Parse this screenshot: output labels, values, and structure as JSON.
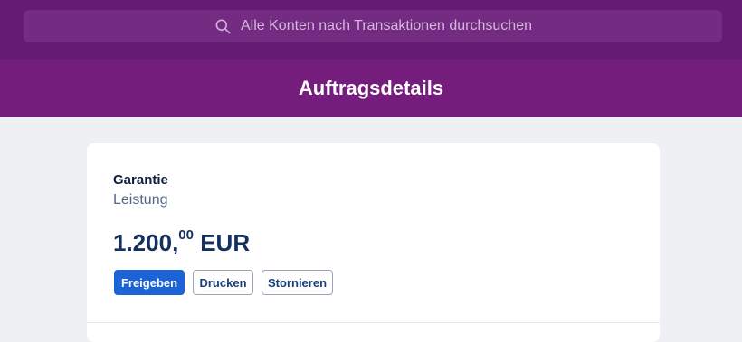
{
  "search": {
    "placeholder": "Alle Konten nach Transaktionen durchsuchen"
  },
  "header": {
    "title": "Auftragsdetails"
  },
  "card": {
    "type_label": "Garantie",
    "category_label": "Leistung",
    "amount": {
      "main": "1.200,",
      "decimals": "00",
      "currency": "EUR"
    },
    "buttons": {
      "release": "Freigeben",
      "print": "Drucken",
      "cancel": "Stornieren"
    }
  },
  "colors": {
    "topbar": "#651a73",
    "header": "#741d7c",
    "primary_button": "#1b63d6",
    "background": "#eef0f3"
  }
}
